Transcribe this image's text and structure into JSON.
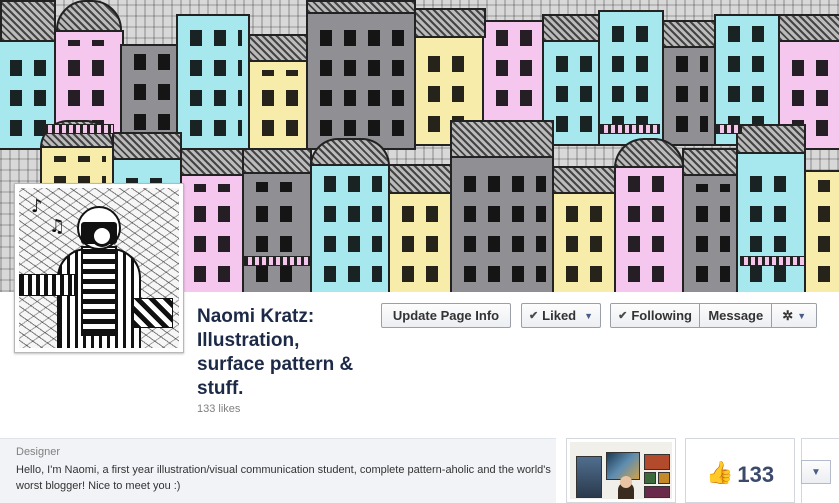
{
  "page": {
    "name": "Naomi Kratz: Illustration, surface pattern & stuff.",
    "likes_label": "133 likes"
  },
  "actions": {
    "update_info": "Update Page Info",
    "liked": "Liked",
    "following": "Following",
    "message": "Message",
    "check_glyph": "✔",
    "chevron_glyph": "▼",
    "gear_glyph": "✲"
  },
  "about": {
    "category": "Designer",
    "text": "Hello, I'm Naomi, a first year illustration/visual communication student, complete pattern-aholic and the world's worst blogger! Nice to meet you :)"
  },
  "tiles": {
    "likes_count": "133",
    "thumb_glyph": "👍"
  },
  "profile_art": {
    "note1": "♪",
    "note2": "♫"
  },
  "colors": {
    "cover_blue": "#a7e8ef",
    "cover_pink": "#f5c7ee",
    "cover_yellow": "#f8ecab",
    "cover_grey": "#8f8f94",
    "page_name": "#1c2a47",
    "about_bg": "#f2f3f7",
    "thumb": "#4a66a0"
  }
}
